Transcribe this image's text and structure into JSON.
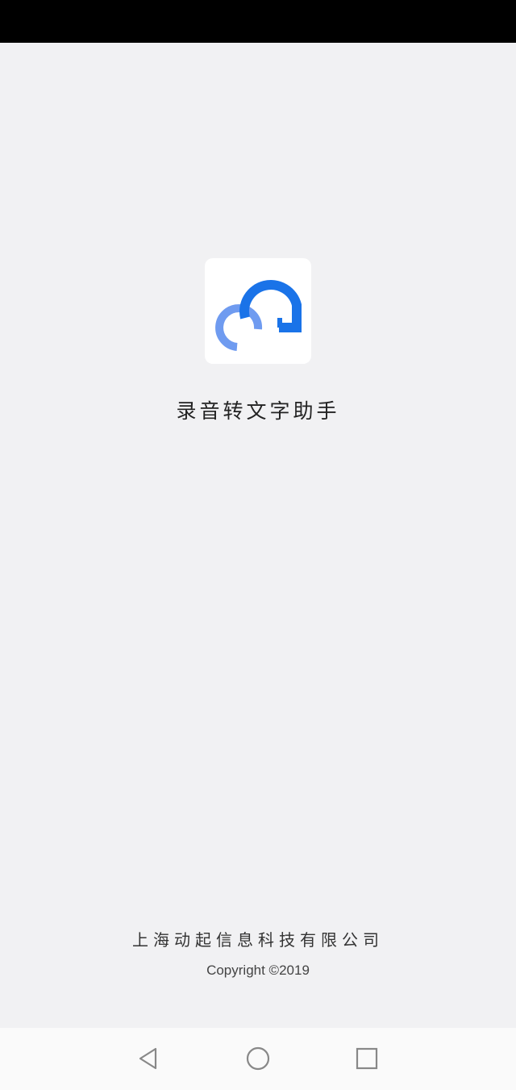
{
  "app": {
    "name": "录音转文字助手",
    "company": "上海动起信息科技有限公司",
    "copyright": "Copyright ©2019",
    "icon": "app-logo-icon"
  },
  "colors": {
    "background": "#f1f1f3",
    "status_bar": "#000000",
    "logo_primary": "#1a73e8",
    "logo_secondary": "#6f9bf0",
    "nav_bar": "#fafafa",
    "nav_icon": "#888888"
  },
  "nav_bar": {
    "buttons": [
      {
        "name": "back",
        "icon": "back-triangle-icon"
      },
      {
        "name": "home",
        "icon": "home-circle-icon"
      },
      {
        "name": "recent",
        "icon": "recent-square-icon"
      }
    ]
  }
}
